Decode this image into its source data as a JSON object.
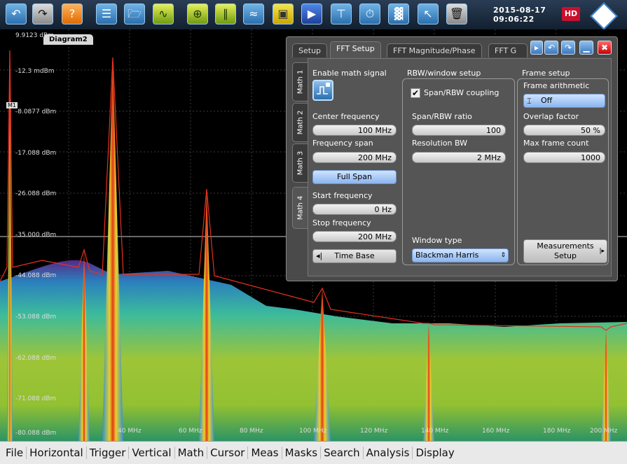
{
  "toolbar": {
    "datetime_date": "2015-08-17",
    "datetime_time": "09:06:22",
    "hd_badge": "HD"
  },
  "diagram": {
    "tab_label": "Diagram2",
    "marker_label": "M1",
    "y_labels": [
      "9.9123 dBm",
      "-12.3 mdBm",
      "-8.0877 dBm",
      "-17.088 dBm",
      "-26.088 dBm",
      "-35.000 dBm",
      "-44.088 dBm",
      "-53.088 dBm",
      "-62.088 dBm",
      "-71.088 dBm",
      "-80.088 dBm"
    ],
    "x_labels": [
      "40 MHz",
      "60 MHz",
      "80 MHz",
      "100 MHz",
      "120 MHz",
      "140 MHz",
      "160 MHz",
      "180 MHz",
      "200 MHz"
    ]
  },
  "dialog": {
    "tabs": [
      "Setup",
      "FFT Setup",
      "FFT Magnitude/Phase",
      "FFT G"
    ],
    "active_tab": "FFT Setup",
    "math_tabs": [
      "Math 1",
      "Math 2",
      "Math 3",
      "Math 4"
    ],
    "col1": {
      "enable_label": "Enable math signal",
      "center_label": "Center frequency",
      "center_value": "100 MHz",
      "span_label": "Frequency span",
      "span_value": "200 MHz",
      "full_span": "Full Span",
      "start_label": "Start frequency",
      "start_value": "0 Hz",
      "stop_label": "Stop frequency",
      "stop_value": "200 MHz",
      "time_base": "Time Base"
    },
    "col2": {
      "title": "RBW/window setup",
      "coupling_label": "Span/RBW coupling",
      "ratio_label": "Span/RBW ratio",
      "ratio_value": "100",
      "rbw_label": "Resolution BW",
      "rbw_value": "2 MHz",
      "window_label": "Window type",
      "window_value": "Blackman Harris"
    },
    "col3": {
      "title": "Frame setup",
      "arith_label": "Frame arithmetic",
      "arith_value": "Off",
      "overlap_label": "Overlap factor",
      "overlap_value": "50 %",
      "max_label": "Max frame count",
      "max_value": "1000",
      "meas_line1": "Measurements",
      "meas_line2": "Setup"
    }
  },
  "menubar": [
    "File",
    "Horizontal",
    "Trigger",
    "Vertical",
    "Math",
    "Cursor",
    "Meas",
    "Masks",
    "Search",
    "Analysis",
    "Display"
  ]
}
